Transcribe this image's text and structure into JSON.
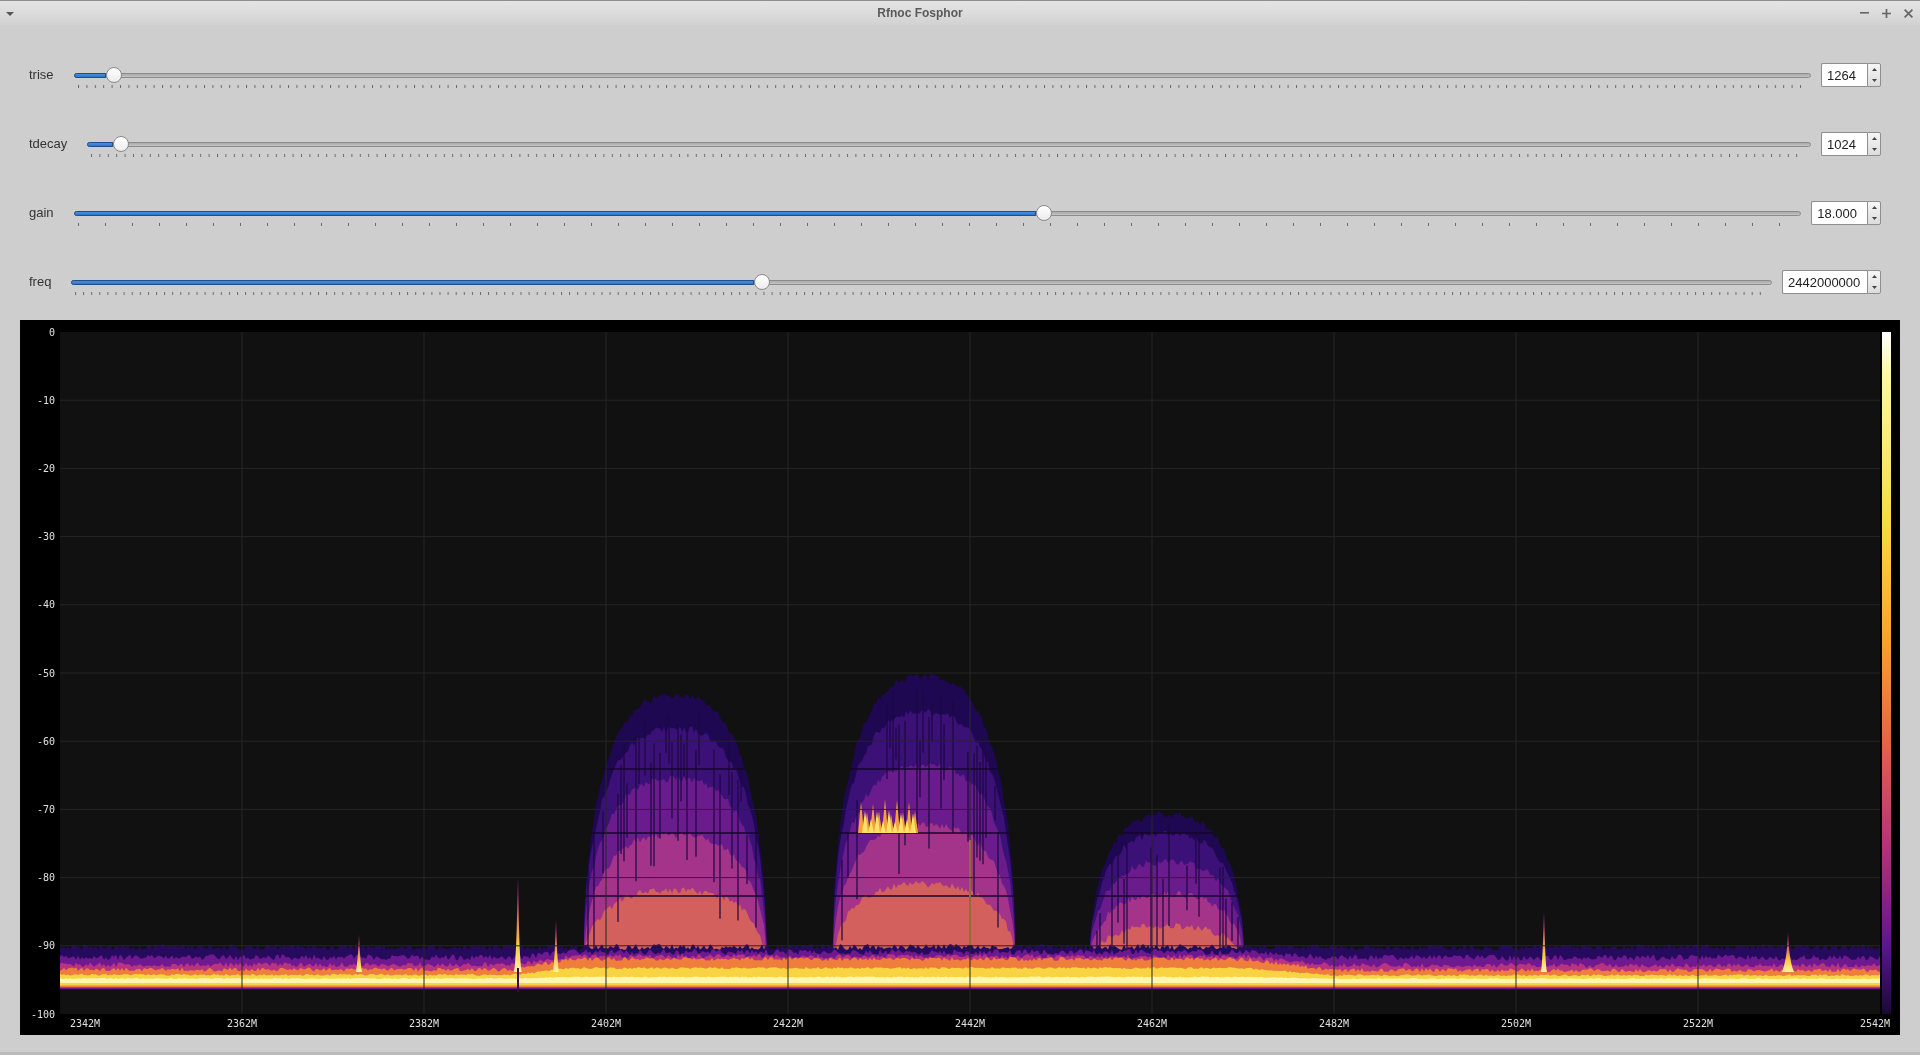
{
  "window": {
    "title": "Rfnoc Fosphor"
  },
  "controls": [
    {
      "label": "trise",
      "level": 0.023,
      "value": "1264"
    },
    {
      "label": "tdecay",
      "level": 0.019,
      "value": "1024"
    },
    {
      "label": "gain",
      "level": 0.562,
      "value": "18.000"
    },
    {
      "label": "freq",
      "level": 0.406,
      "value": "2442000000"
    }
  ],
  "spectrum": {
    "y_axis_labels": [
      "0",
      "-10",
      "-20",
      "-30",
      "-40",
      "-50",
      "-60",
      "-70",
      "-80",
      "-90",
      "-100"
    ],
    "x_axis_labels": [
      "2342M",
      "2362M",
      "2382M",
      "2402M",
      "2422M",
      "2442M",
      "2462M",
      "2482M",
      "2502M",
      "2522M",
      "2542M"
    ]
  }
}
